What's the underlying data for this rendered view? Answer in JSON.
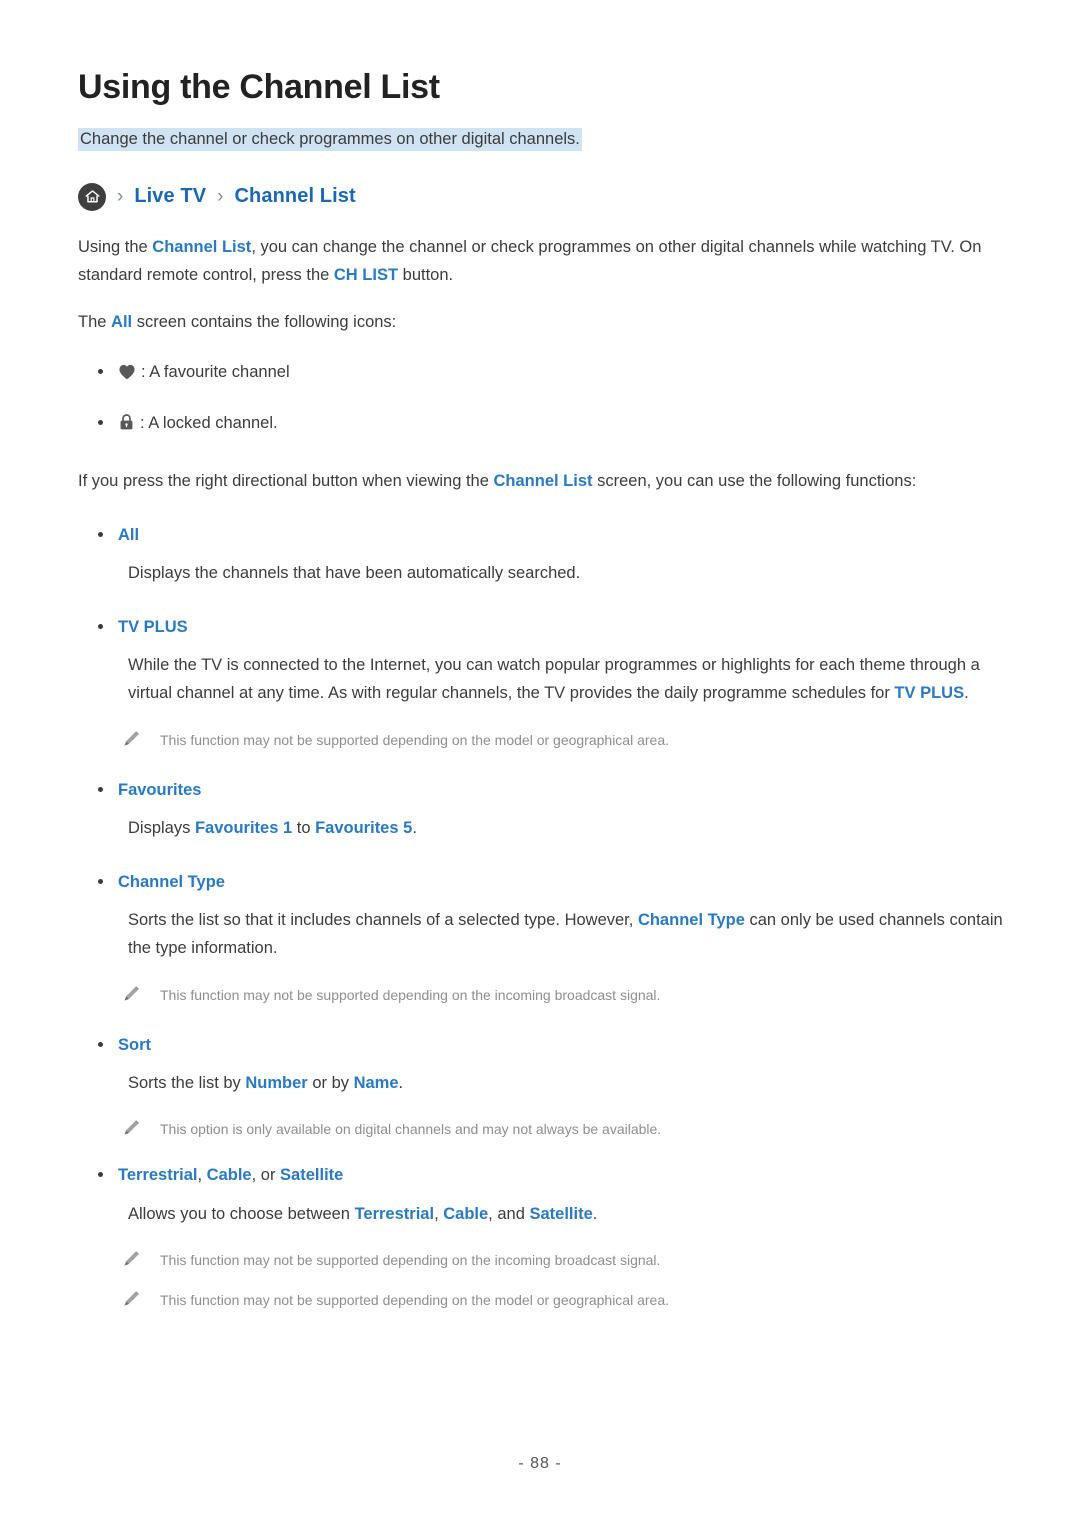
{
  "document": {
    "title": "Using the Channel List",
    "subtitle": "Change the channel or check programmes on other digital channels.",
    "page_number": "- 88 -"
  },
  "colors": {
    "link_blue": "#2a7ac2",
    "breadcrumb_blue": "#1a68b3",
    "highlight_bg": "#cfe3f3",
    "body_text": "#3c3c3c",
    "note_text": "#8e8e8e",
    "icon_gray": "#585858"
  },
  "breadcrumb": {
    "home_icon": "home-icon",
    "separator": "›",
    "items": [
      {
        "label": "Live TV"
      },
      {
        "label": "Channel List"
      }
    ]
  },
  "intro": {
    "line1_a": "Using the ",
    "line1_link": "Channel List",
    "line1_b": ", you can change the channel or check programmes on other digital channels while watching TV. On standard remote control, press the ",
    "line1_link2": "CH LIST",
    "line1_c": " button."
  },
  "icons_intro": {
    "prefix": "The ",
    "link": "All",
    "suffix": " screen contains the following icons:",
    "items": [
      {
        "icon": "heart-icon",
        "text": ": A favourite channel"
      },
      {
        "icon": "lock-icon",
        "text": ": A locked channel."
      }
    ]
  },
  "functions_intro": {
    "a": "If you press the right directional button when viewing the ",
    "link": "Channel List",
    "b": " screen, you can use the following functions:"
  },
  "functions": [
    {
      "label": "All",
      "description": "Displays the channels that have been automatically searched.",
      "notes": []
    },
    {
      "label": "TV PLUS",
      "description_a": "While the TV is connected to the Internet, you can watch popular programmes or highlights for each theme through a virtual channel at any time. As with regular channels, the TV provides the daily programme schedules for ",
      "description_link": "TV PLUS",
      "description_b": ".",
      "notes": [
        "This function may not be supported depending on the model or geographical area."
      ]
    },
    {
      "label": "Favourites",
      "description_a": "Displays ",
      "description_link": "Favourites 1",
      "description_b": " to ",
      "description_link2": "Favourites 5",
      "description_c": ".",
      "notes": []
    },
    {
      "label": "Channel Type",
      "description_a": "Sorts the list so that it includes channels of a selected type. However, ",
      "description_link": "Channel Type",
      "description_b": " can only be used channels contain the type information.",
      "notes": [
        "This function may not be supported depending on the incoming broadcast signal."
      ]
    },
    {
      "label": "Sort",
      "description_a": "Sorts the list by ",
      "description_link": "Number",
      "description_b": " or by ",
      "description_link2": "Name",
      "description_c": ".",
      "notes": [
        "This option is only available on digital channels and may not always be available."
      ]
    },
    {
      "label_link1": "Terrestrial",
      "label_sep1": ", ",
      "label_link2": "Cable",
      "label_sep2": ", or ",
      "label_link3": "Satellite",
      "description_a": "Allows you to choose between ",
      "description_link": "Terrestrial",
      "description_b": ", ",
      "description_link2": "Cable",
      "description_c": ", and ",
      "description_link3": "Satellite",
      "description_d": ".",
      "notes": [
        "This function may not be supported depending on the incoming broadcast signal.",
        "This function may not be supported depending on the model or geographical area."
      ]
    }
  ]
}
